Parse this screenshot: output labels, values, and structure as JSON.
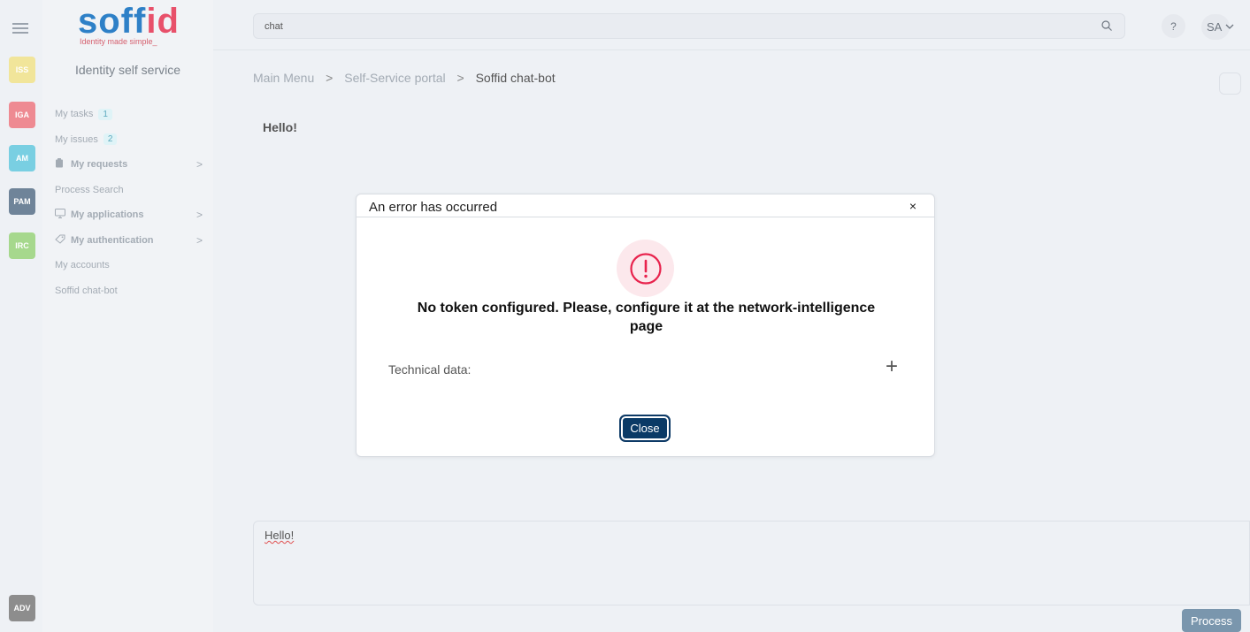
{
  "rail": {
    "items": [
      {
        "label": "ISS",
        "color": "#f1e59a"
      },
      {
        "label": "IGA",
        "color": "#ee8a92"
      },
      {
        "label": "AM",
        "color": "#79cfe2"
      },
      {
        "label": "PAM",
        "color": "#6f8499"
      },
      {
        "label": "IRC",
        "color": "#a6d88d"
      }
    ],
    "bottom": {
      "label": "ADV",
      "color": "#8d8d8d"
    }
  },
  "logo": {
    "word_a": "soff",
    "word_b": "id",
    "tagline": "Identity made simple_"
  },
  "sidebar": {
    "title": "Identity self service",
    "items": [
      {
        "label": "My tasks",
        "count": "1"
      },
      {
        "label": "My issues",
        "count": "2"
      },
      {
        "label": "My requests",
        "icon": "clipboard-icon"
      },
      {
        "label": "Process Search"
      },
      {
        "label": "My applications",
        "icon": "monitor-icon"
      },
      {
        "label": "My authentication",
        "icon": "tag-icon"
      },
      {
        "label": "My accounts"
      },
      {
        "label": "Soffid chat-bot"
      }
    ]
  },
  "header": {
    "search_value": "chat",
    "help_label": "?",
    "user_initials": "SA"
  },
  "breadcrumb": {
    "items": [
      "Main Menu",
      "Self-Service portal",
      "Soffid chat-bot"
    ],
    "separator": ">"
  },
  "chat": {
    "message": "Hello!",
    "input_text": "Hello!",
    "process_label": "Process"
  },
  "modal": {
    "title": "An error has occurred",
    "close_x": "×",
    "message": "No token configured. Please, configure it at the network-intelligence page",
    "tech_label": "Technical data:",
    "expand_label": "+",
    "close_label": "Close",
    "error_color": "#e8234d"
  }
}
